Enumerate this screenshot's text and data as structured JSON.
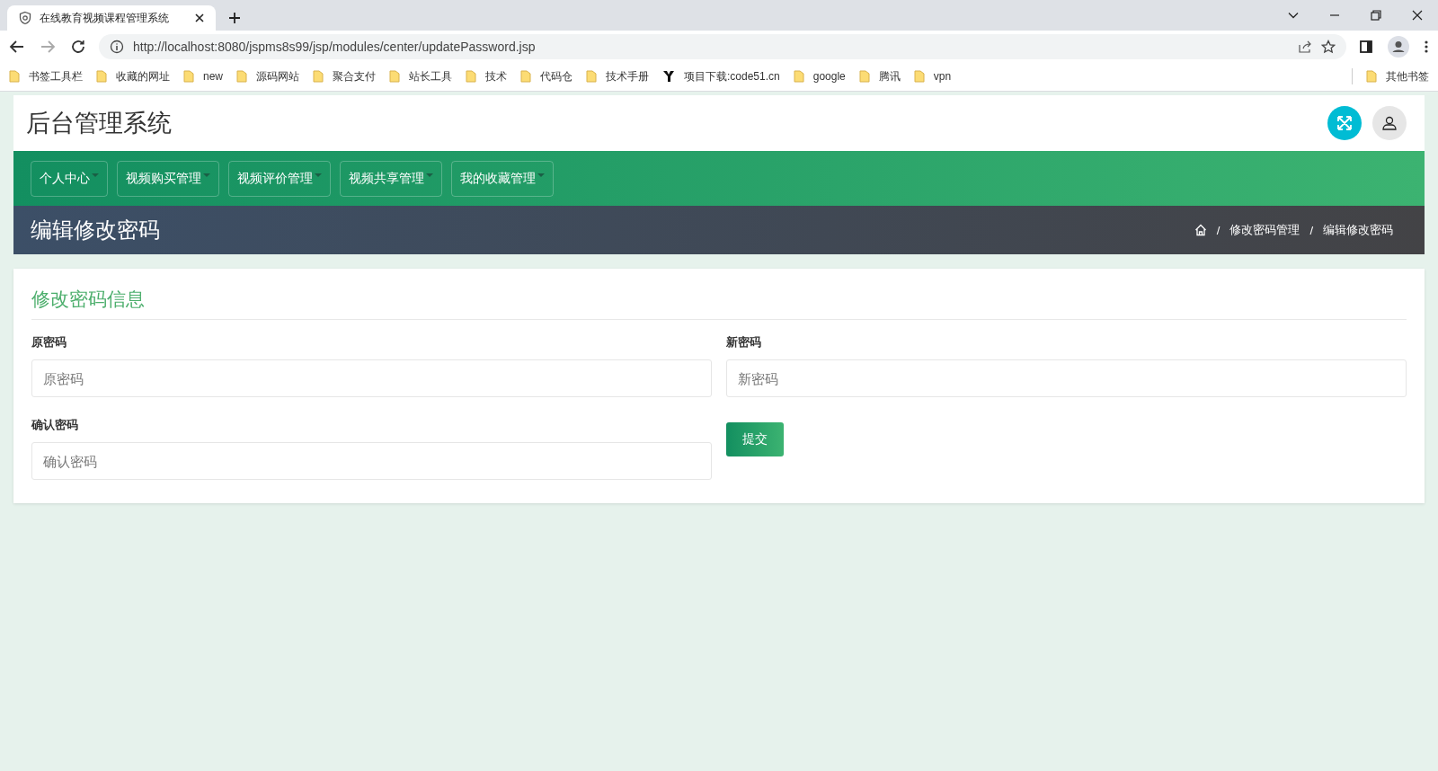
{
  "browser": {
    "tab_title": "在线教育视频课程管理系统",
    "url": "http://localhost:8080/jspms8s99/jsp/modules/center/updatePassword.jsp",
    "bookmarks": [
      {
        "kind": "folder",
        "label": "书签工具栏"
      },
      {
        "kind": "folder",
        "label": "收藏的网址"
      },
      {
        "kind": "folder",
        "label": "new"
      },
      {
        "kind": "folder",
        "label": "源码网站"
      },
      {
        "kind": "folder",
        "label": "聚合支付"
      },
      {
        "kind": "folder",
        "label": "站长工具"
      },
      {
        "kind": "folder",
        "label": "技术"
      },
      {
        "kind": "folder",
        "label": "代码仓"
      },
      {
        "kind": "folder",
        "label": "技术手册"
      },
      {
        "kind": "site",
        "label": "项目下载:code51.cn"
      },
      {
        "kind": "folder",
        "label": "google"
      },
      {
        "kind": "folder",
        "label": "腾讯"
      },
      {
        "kind": "folder",
        "label": "vpn"
      }
    ],
    "other_bookmarks": "其他书签"
  },
  "header": {
    "title": "后台管理系统"
  },
  "nav": [
    {
      "label": "个人中心"
    },
    {
      "label": "视频购买管理"
    },
    {
      "label": "视频评价管理"
    },
    {
      "label": "视频共享管理"
    },
    {
      "label": "我的收藏管理"
    }
  ],
  "page_banner": {
    "title": "编辑修改密码",
    "breadcrumb": [
      {
        "separator": "/",
        "label": "修改密码管理"
      },
      {
        "separator": "/",
        "label": "编辑修改密码"
      }
    ]
  },
  "card": {
    "title": "修改密码信息",
    "fields": [
      {
        "label": "原密码",
        "placeholder": "原密码"
      },
      {
        "label": "新密码",
        "placeholder": "新密码"
      },
      {
        "label": "确认密码",
        "placeholder": "确认密码"
      }
    ],
    "submit": "提交"
  }
}
